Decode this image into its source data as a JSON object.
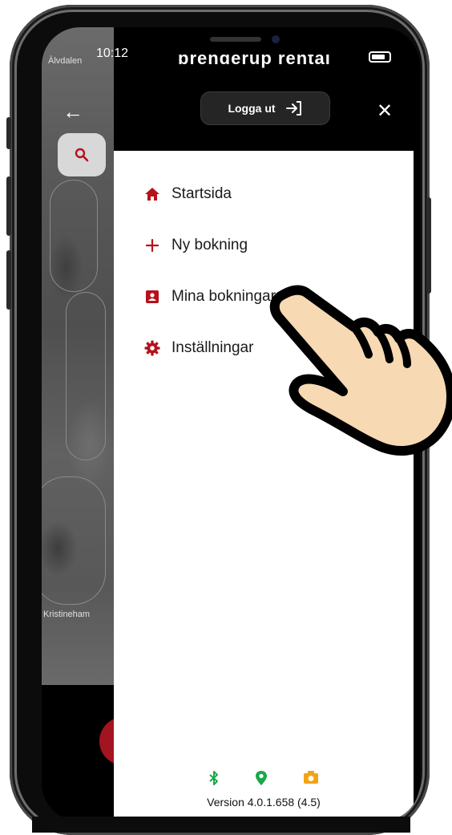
{
  "status_bar": {
    "time": "10:12"
  },
  "map": {
    "label_top": "Älvdalen",
    "label_bottom": "Kristineham"
  },
  "drawer": {
    "brand": "brenderup rental",
    "logout_label": "Logga ut",
    "menu": [
      {
        "label": "Startsida",
        "icon": "home-icon"
      },
      {
        "label": "Ny bokning",
        "icon": "plus-icon"
      },
      {
        "label": "Mina bokningar",
        "icon": "contact-card-icon"
      },
      {
        "label": "Inställningar",
        "icon": "gear-icon"
      }
    ],
    "footer": {
      "icons": [
        "bluetooth-icon",
        "location-pin-icon",
        "camera-icon"
      ],
      "version": "Version 4.0.1.658  (4.5)"
    }
  },
  "colors": {
    "accent_red": "#b5121b",
    "bluetooth_green": "#1aa84a",
    "location_green": "#1aa84a",
    "camera_orange": "#f2a316",
    "hand_fill": "#f7d9b3"
  }
}
